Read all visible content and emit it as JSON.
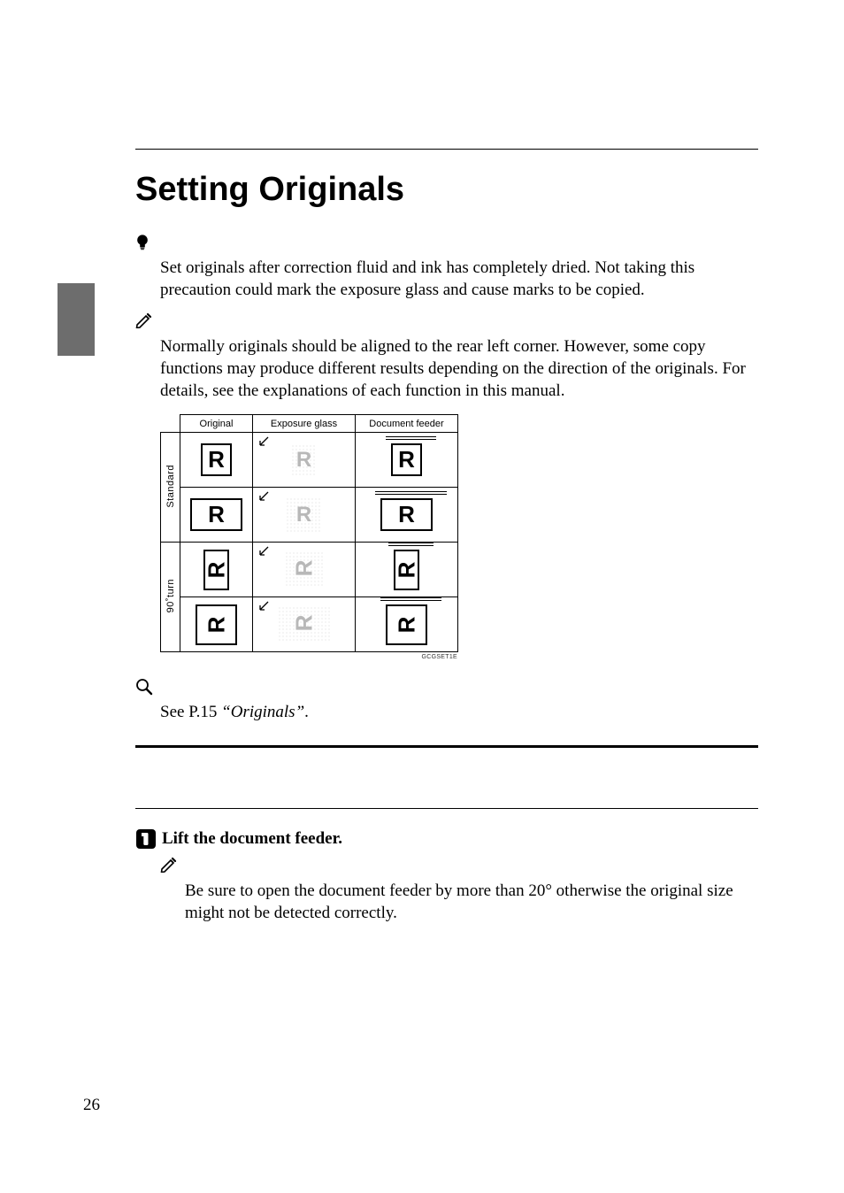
{
  "title": "Setting Originals",
  "limitation": {
    "text": "Set originals after correction fluid and ink has completely dried. Not taking this precaution could mark the exposure glass and cause marks to be copied."
  },
  "note1": {
    "text": "Normally originals should be aligned to the rear left corner. However, some copy functions may produce different results depending on the direction of the originals. For details, see the explanations of each function in this manual."
  },
  "diagram": {
    "headers": {
      "c1": "Original",
      "c2": "Exposure glass",
      "c3": "Document feeder"
    },
    "row_labels": {
      "r1": "Standard",
      "r2": "90˚turn"
    },
    "glyph": "R",
    "code": "GCGSET1E"
  },
  "reference": {
    "see": "See ",
    "page": "P.15 ",
    "title": "“Originals”",
    "tail": "."
  },
  "section": {
    "step1": "Lift the document feeder.",
    "note": "Be sure to open the document feeder by more than 20° otherwise the original size might not be detected correctly."
  },
  "page_number": "26"
}
